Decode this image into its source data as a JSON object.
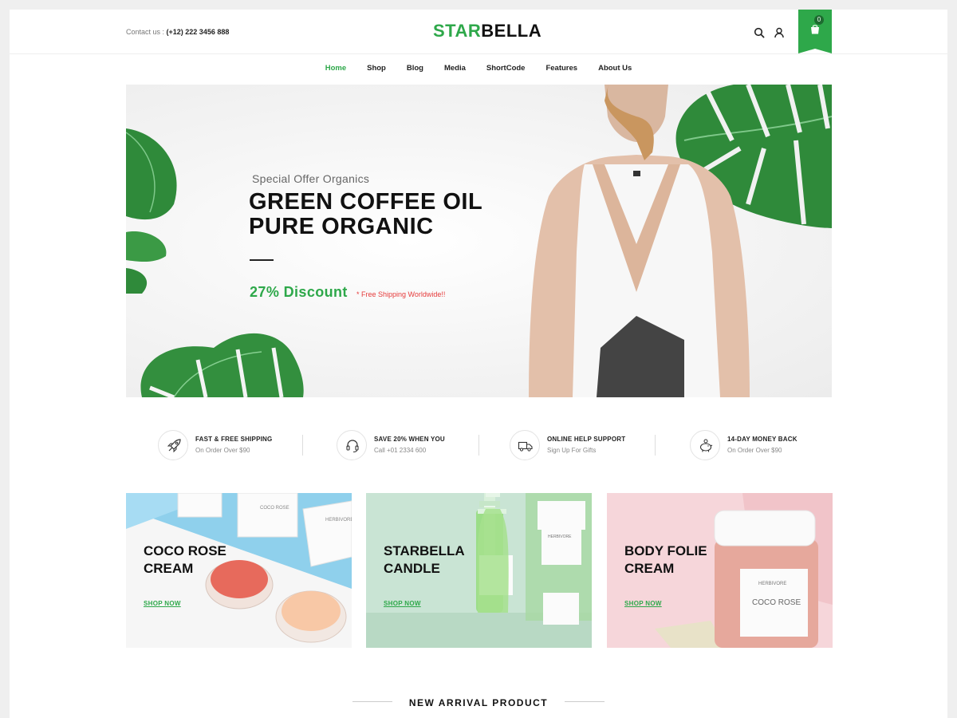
{
  "header": {
    "contact_label": "Contact us : ",
    "contact_phone": "(+12) 222 3456 888",
    "logo_part1": "STAR",
    "logo_part2": "BELLA",
    "cart_count": "0"
  },
  "nav": {
    "items": [
      "Home",
      "Shop",
      "Blog",
      "Media",
      "ShortCode",
      "Features",
      "About Us"
    ],
    "active": "Home"
  },
  "hero": {
    "subtitle": "Special Offer Organics",
    "title_line1": "GREEN COFFEE OIL",
    "title_line2": "PURE ORGANIC",
    "discount": "27% Discount",
    "shipping": "* Free Shipping Worldwide!!"
  },
  "features": [
    {
      "title": "FAST & FREE SHIPPING",
      "sub": "On Order Over $90",
      "icon": "rocket-icon"
    },
    {
      "title": "SAVE 20% WHEN YOU",
      "sub": "Call +01 2334 600",
      "icon": "headset-icon"
    },
    {
      "title": "ONLINE HELP SUPPORT",
      "sub": "Sign Up For Gifts",
      "icon": "truck-icon"
    },
    {
      "title": "14-DAY MONEY BACK",
      "sub": "On Order Over $90",
      "icon": "piggy-bank-icon"
    }
  ],
  "promos": [
    {
      "line1": "COCO ROSE",
      "line2": "CREAM",
      "link": "SHOP NOW"
    },
    {
      "line1": "STARBELLA",
      "line2": "CANDLE",
      "link": "SHOP NOW"
    },
    {
      "line1": "BODY FOLIE",
      "line2": "CREAM",
      "link": "SHOP NOW"
    }
  ],
  "product_labels": {
    "brand": "HERBIVORE",
    "coco_rose": "COCO ROSE",
    "jasmine": "JASMINE GREEN TEA"
  },
  "section": {
    "title": "NEW ARRIVAL PRODUCT"
  },
  "colors": {
    "accent": "#2ea84a",
    "shipping_note": "#e53b3b"
  }
}
